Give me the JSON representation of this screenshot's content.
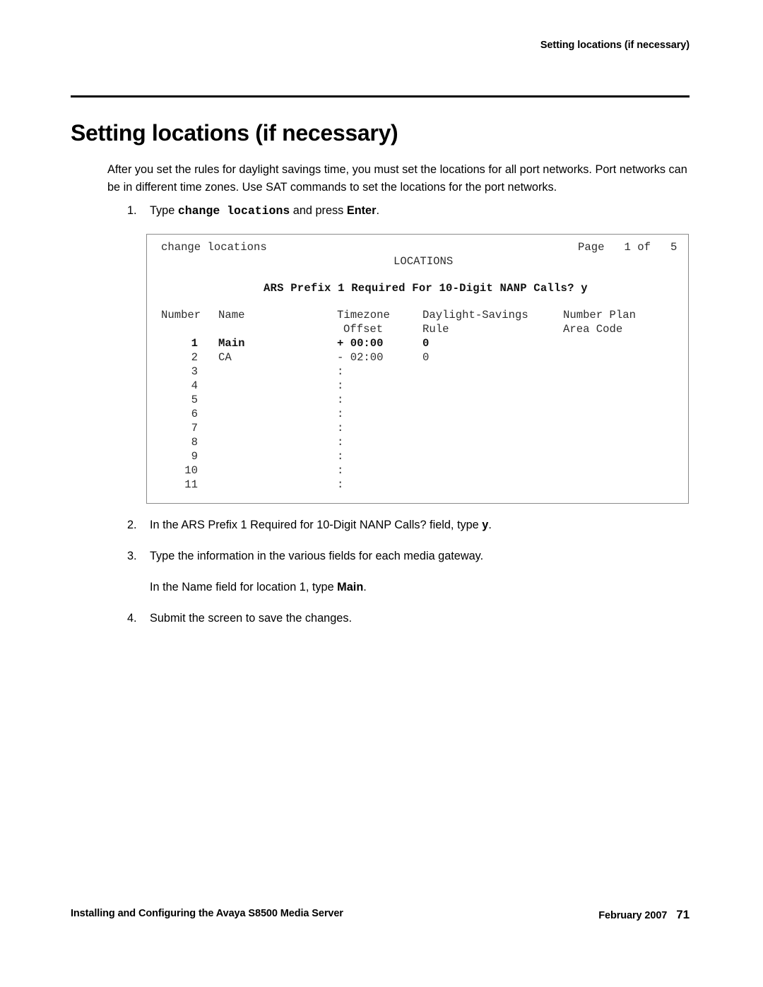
{
  "header": {
    "running_head": "Setting locations (if necessary)"
  },
  "title": "Setting locations (if necessary)",
  "intro": "After you set the rules for daylight savings time, you must set the locations for all port networks. Port networks can be in different time zones. Use SAT commands to set the locations for the port networks.",
  "steps": [
    {
      "num": "1.",
      "pre": "Type ",
      "mono": "change locations",
      "mid": " and press ",
      "bold": "Enter",
      "post": "."
    },
    {
      "num": "2.",
      "pre": "In the ARS Prefix 1 Required for 10-Digit NANP Calls? field, type ",
      "bold": "y",
      "post": "."
    },
    {
      "num": "3.",
      "text": "Type the information in the various fields for each media gateway.",
      "sub_pre": "In the Name field for location 1, type ",
      "sub_bold": "Main",
      "sub_post": "."
    },
    {
      "num": "4.",
      "text": "Submit the screen to save the changes."
    }
  ],
  "sat_screen": {
    "command": "change locations",
    "page_label": "Page   1 of   5",
    "screen_name": "LOCATIONS",
    "prefix_field": "ARS Prefix 1 Required For 10-Digit NANP Calls? y",
    "headers_line1": {
      "number": "Number",
      "name": "Name",
      "timezone": "Timezone",
      "dst": "Daylight-Savings",
      "npa": "Number Plan"
    },
    "headers_line2": {
      "timezone": "Offset",
      "dst": "Rule",
      "npa": "Area Code"
    },
    "rows": [
      {
        "number": "1",
        "name": "Main",
        "timezone": "+ 00:00",
        "dst": "0",
        "npa": "",
        "bold": true
      },
      {
        "number": "2",
        "name": "CA",
        "timezone": "- 02:00",
        "dst": "0",
        "npa": "",
        "bold": false
      },
      {
        "number": "3",
        "name": "",
        "timezone": ":",
        "dst": "",
        "npa": "",
        "bold": false
      },
      {
        "number": "4",
        "name": "",
        "timezone": ":",
        "dst": "",
        "npa": "",
        "bold": false
      },
      {
        "number": "5",
        "name": "",
        "timezone": ":",
        "dst": "",
        "npa": "",
        "bold": false
      },
      {
        "number": "6",
        "name": "",
        "timezone": ":",
        "dst": "",
        "npa": "",
        "bold": false
      },
      {
        "number": "7",
        "name": "",
        "timezone": ":",
        "dst": "",
        "npa": "",
        "bold": false
      },
      {
        "number": "8",
        "name": "",
        "timezone": ":",
        "dst": "",
        "npa": "",
        "bold": false
      },
      {
        "number": "9",
        "name": "",
        "timezone": ":",
        "dst": "",
        "npa": "",
        "bold": false
      },
      {
        "number": "10",
        "name": "",
        "timezone": ":",
        "dst": "",
        "npa": "",
        "bold": false
      },
      {
        "number": "11",
        "name": "",
        "timezone": ":",
        "dst": "",
        "npa": "",
        "bold": false
      }
    ]
  },
  "footer": {
    "left": "Installing and Configuring the Avaya S8500 Media Server",
    "date": "February 2007",
    "page_number": "71"
  },
  "colors": {
    "text": "#000000",
    "terminal_text": "#2c2c2c",
    "box_border": "#8a8a8a",
    "rule": "#000000",
    "background": "#ffffff"
  }
}
